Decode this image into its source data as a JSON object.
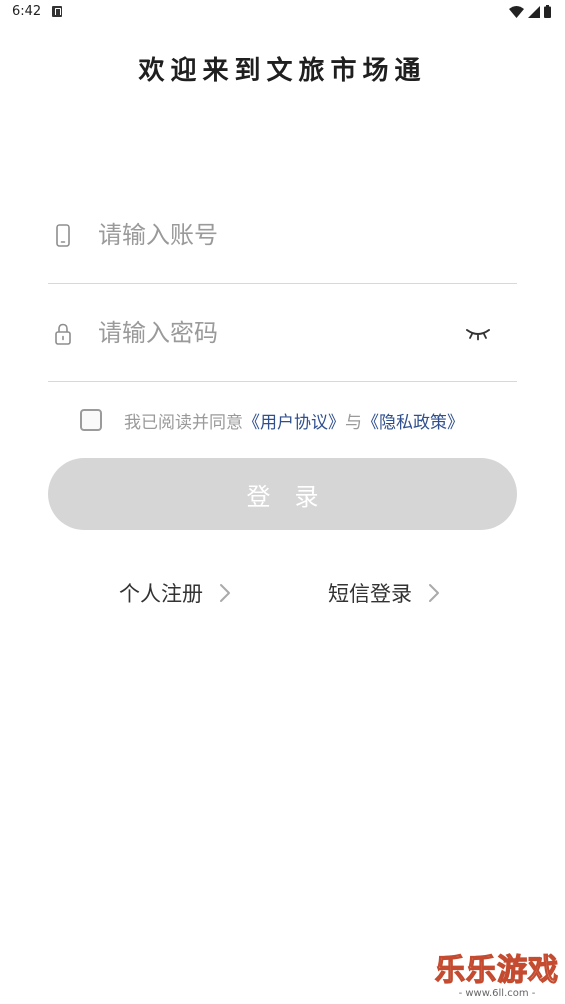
{
  "status_bar": {
    "time": "6:42",
    "icons": [
      "notification-icon",
      "wifi-icon",
      "signal-icon",
      "battery-icon"
    ]
  },
  "title": "欢迎来到文旅市场通",
  "account_field": {
    "placeholder": "请输入账号",
    "value": "",
    "icon": "phone-icon"
  },
  "password_field": {
    "placeholder": "请输入密码",
    "value": "",
    "icon": "lock-icon",
    "toggle_icon": "eye-closed-icon"
  },
  "agreement": {
    "checked": false,
    "prefix": "我已阅读并同意",
    "user_agreement": "《用户协议》",
    "connector": "与",
    "privacy_policy": "《隐私政策》"
  },
  "login_button": {
    "label": "登录"
  },
  "links": {
    "register": "个人注册",
    "sms_login": "短信登录"
  },
  "watermark": {
    "main": "乐乐游戏",
    "sub": "- www.6ll.com -"
  },
  "colors": {
    "link": "#2f4f8f",
    "button_disabled": "#d6d6d6",
    "placeholder": "#9a9a9a"
  }
}
